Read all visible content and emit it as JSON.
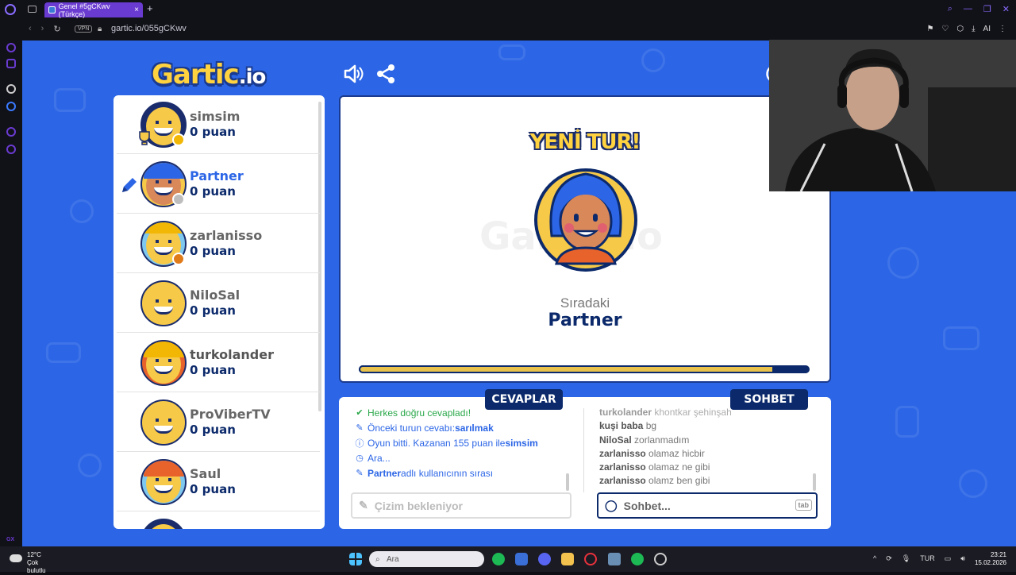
{
  "browser": {
    "tab_title": "Genel #5gCKwv (Türkçe)",
    "url": "gartic.io/055gCKwv",
    "vpn_label": "VPN",
    "ai_label": "AI",
    "gx_label": "GX"
  },
  "game": {
    "logo_main": "Gartic",
    "logo_suffix": ".io",
    "players": [
      {
        "name": "simsim",
        "score": "0 puan"
      },
      {
        "name": "Partner",
        "score": "0 puan"
      },
      {
        "name": "zarlanisso",
        "score": "0 puan"
      },
      {
        "name": "NiloSal",
        "score": "0 puan"
      },
      {
        "name": "turkolander",
        "score": "0 puan"
      },
      {
        "name": "ProViberTV",
        "score": "0 puan"
      },
      {
        "name": "Saul",
        "score": "0 puan"
      }
    ],
    "round": {
      "banner": "YENİ TUR!",
      "next_label": "Sıradaki",
      "next_player": "Partner",
      "progress": 0.92
    },
    "answers_tab": "CEVAPLAR",
    "chat_tab": "SOHBET",
    "answers": [
      {
        "text": "Herkes doğru cevapladı!"
      },
      {
        "prefix": "Önceki turun cevabı: ",
        "highlight": "sarılmak"
      },
      {
        "prefix": "Oyun bitti. Kazanan 155 puan ile ",
        "highlight": "simsim"
      },
      {
        "text": "Ara..."
      },
      {
        "highlight": "Partner",
        "suffix": " adlı kullanıcının sırası"
      }
    ],
    "chat": [
      {
        "user": "turkolander",
        "msg": "khontkar şehinşah"
      },
      {
        "user": "kuşi baba",
        "msg": "bg"
      },
      {
        "user": "NiloSal",
        "msg": "zorlanmadım"
      },
      {
        "user": "zarlanisso",
        "msg": "olamaz hicbir"
      },
      {
        "user": "zarlanisso",
        "msg": "olamaz ne gibi"
      },
      {
        "user": "zarlanisso",
        "msg": "olamz ben gibi"
      }
    ],
    "answer_placeholder": "Çizim bekleniyor",
    "chat_placeholder": "Sohbet...",
    "tab_key": "tab"
  },
  "taskbar": {
    "temperature": "12°C",
    "weather": "Çok bulutlu",
    "search": "Ara",
    "lang": "TUR",
    "time": "23:21",
    "date": "15.02.2026"
  }
}
